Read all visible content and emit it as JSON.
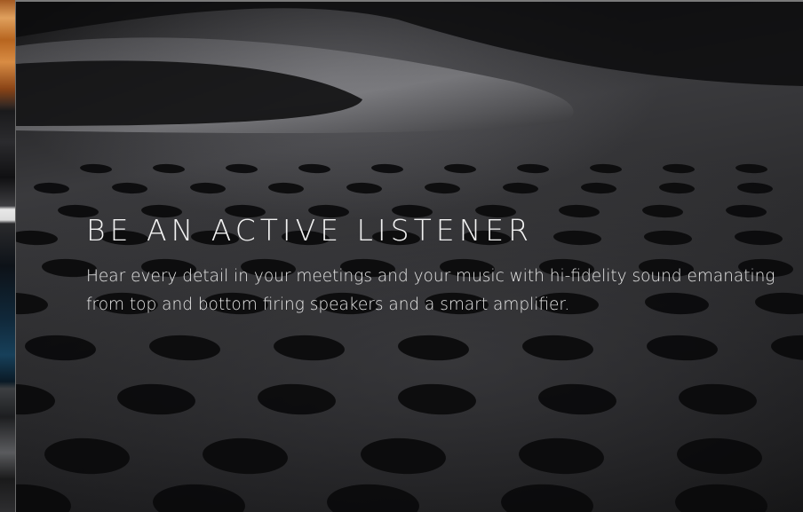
{
  "hero": {
    "headline": "BE AN ACTIVE LISTENER",
    "body": "Hear every detail in your meetings and your music with hi-fidelity sound emanating from top and bottom firing speakers and a smart amplifier.",
    "image": "speaker-grille-closeup"
  },
  "colors": {
    "text": "#f2f2f2",
    "background": "#2a2a2c"
  }
}
